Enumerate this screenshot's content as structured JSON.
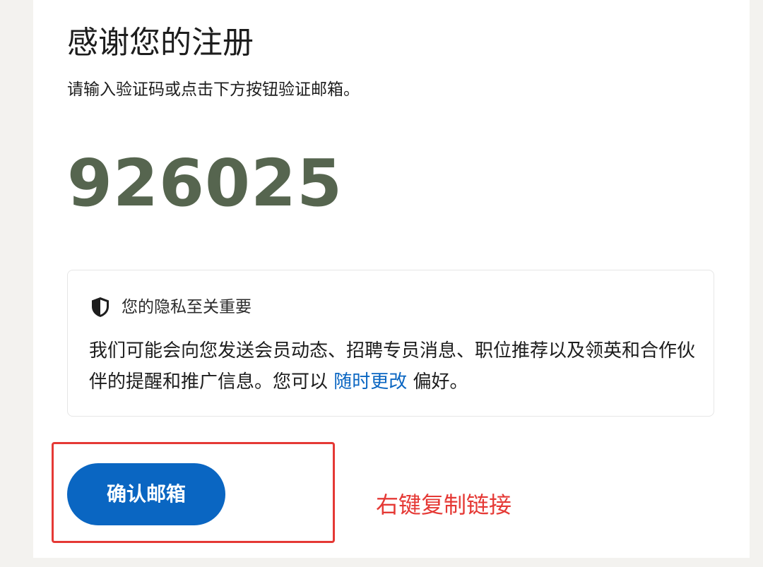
{
  "page": {
    "title": "感谢您的注册",
    "subtitle": "请输入验证码或点击下方按钮验证邮箱。",
    "verification_code": "926025"
  },
  "privacy": {
    "icon": "shield-icon",
    "title": "您的隐私至关重要",
    "body_before": "我们可能会向您发送会员动态、招聘专员消息、职位推荐以及领英和合作伙伴的提醒和推广信息。您可以 ",
    "link_text": "随时更改",
    "body_after": " 偏好。"
  },
  "actions": {
    "confirm_label": "确认邮箱"
  },
  "annotation": {
    "text": "右键复制链接",
    "color": "#e53935"
  },
  "colors": {
    "accent": "#0a66c2",
    "code": "#56654f"
  }
}
